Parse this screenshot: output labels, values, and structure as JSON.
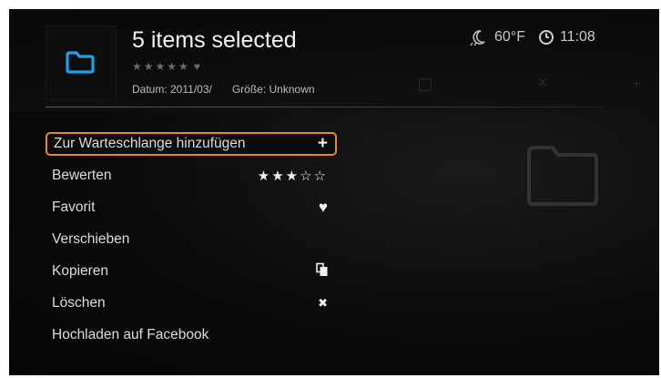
{
  "header": {
    "title": "5 items selected",
    "rating_stars": "★★★★★",
    "heart": "♥",
    "date": "Datum: 2011/03/",
    "size": "Größe: Unknown"
  },
  "status": {
    "temperature": "60°F",
    "time": "11:08",
    "weather_icon": "weather-icon",
    "clock_icon": "clock-icon"
  },
  "menu": {
    "items": [
      {
        "label": "Zur Warteschlange hinzufügen",
        "action": "+",
        "selected": true
      },
      {
        "label": "Bewerten",
        "action": "★★★☆☆"
      },
      {
        "label": "Favorit",
        "action": "♥"
      },
      {
        "label": "Verschieben",
        "action": ""
      },
      {
        "label": "Kopieren",
        "action": "copy-icon"
      },
      {
        "label": "Löschen",
        "action": "✖"
      },
      {
        "label": "Hochladen auf Facebook",
        "action": ""
      }
    ]
  },
  "colors": {
    "accent": "#e38a2e",
    "folder": "#1ea0e6",
    "background": "#050505"
  }
}
